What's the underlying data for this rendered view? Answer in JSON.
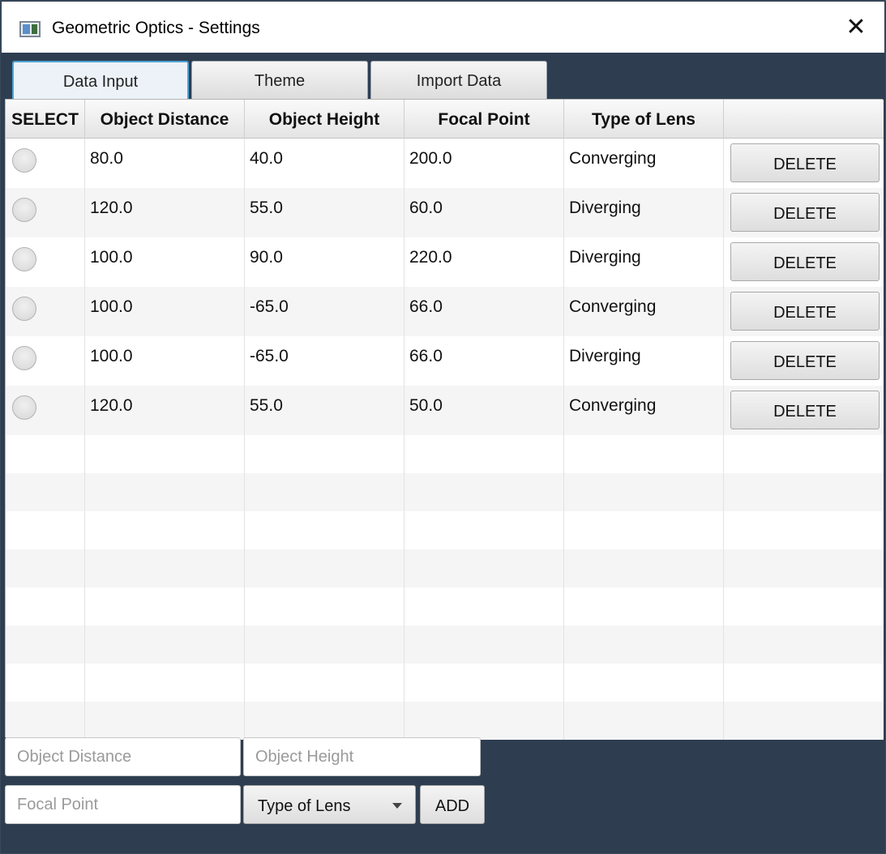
{
  "window": {
    "title": "Geometric Optics - Settings",
    "close_glyph": "✕"
  },
  "tabs": [
    {
      "label": "Data Input",
      "active": true
    },
    {
      "label": "Theme",
      "active": false
    },
    {
      "label": "Import Data",
      "active": false
    }
  ],
  "table": {
    "columns": [
      "SELECT",
      "Object Distance",
      "Object Height",
      "Focal Point",
      "Type of Lens",
      ""
    ],
    "rows": [
      {
        "distance": "80.0",
        "height": "40.0",
        "focal": "200.0",
        "lens": "Converging",
        "action": "DELETE"
      },
      {
        "distance": "120.0",
        "height": "55.0",
        "focal": "60.0",
        "lens": "Diverging",
        "action": "DELETE"
      },
      {
        "distance": "100.0",
        "height": "90.0",
        "focal": "220.0",
        "lens": "Diverging",
        "action": "DELETE"
      },
      {
        "distance": "100.0",
        "height": "-65.0",
        "focal": "66.0",
        "lens": "Converging",
        "action": "DELETE"
      },
      {
        "distance": "100.0",
        "height": "-65.0",
        "focal": "66.0",
        "lens": "Diverging",
        "action": "DELETE"
      },
      {
        "distance": "120.0",
        "height": "55.0",
        "focal": "50.0",
        "lens": "Converging",
        "action": "DELETE"
      }
    ]
  },
  "form": {
    "object_distance_placeholder": "Object Distance",
    "object_height_placeholder": "Object Height",
    "focal_point_placeholder": "Focal Point",
    "lens_type_selected": "Type of Lens",
    "add_label": "ADD"
  },
  "colors": {
    "background": "#2e3e50",
    "active_tab_border": "#4da3d8"
  }
}
